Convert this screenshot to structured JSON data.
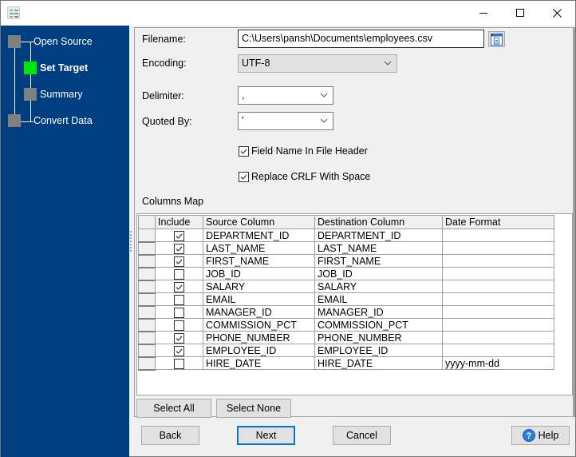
{
  "window": {
    "app_icon": "app-grid-icon",
    "controls": {
      "minimize": "minimize-icon",
      "maximize": "maximize-icon",
      "close": "close-icon"
    }
  },
  "sidebar": {
    "steps": [
      {
        "label": "Open Source",
        "state": "inactive"
      },
      {
        "label": "Set Target",
        "state": "active"
      },
      {
        "label": "Summary",
        "state": "inactive"
      },
      {
        "label": "Convert Data",
        "state": "inactive"
      }
    ],
    "colors": {
      "background": "#003f7f",
      "active": "#00e600",
      "inactive": "#808080"
    }
  },
  "form": {
    "filename_label": "Filename:",
    "filename_value": "C:\\Users\\pansh\\Documents\\employees.csv",
    "encoding_label": "Encoding:",
    "encoding_value": "UTF-8",
    "delimiter_label": "Delimiter:",
    "delimiter_value": ",",
    "quoted_by_label": "Quoted By:",
    "quoted_by_value": "'",
    "field_name_header_label": "Field Name In File Header",
    "field_name_header_checked": true,
    "replace_crlf_label": "Replace CRLF With Space",
    "replace_crlf_checked": true,
    "columns_map_label": "Columns Map"
  },
  "grid": {
    "headers": [
      "Include",
      "Source Column",
      "Destination Column",
      "Date Format"
    ],
    "rows": [
      {
        "include": true,
        "source": "DEPARTMENT_ID",
        "destination": "DEPARTMENT_ID",
        "date_format": ""
      },
      {
        "include": true,
        "source": "LAST_NAME",
        "destination": "LAST_NAME",
        "date_format": ""
      },
      {
        "include": true,
        "source": "FIRST_NAME",
        "destination": "FIRST_NAME",
        "date_format": ""
      },
      {
        "include": false,
        "source": "JOB_ID",
        "destination": "JOB_ID",
        "date_format": ""
      },
      {
        "include": true,
        "source": "SALARY",
        "destination": "SALARY",
        "date_format": ""
      },
      {
        "include": false,
        "source": "EMAIL",
        "destination": "EMAIL",
        "date_format": ""
      },
      {
        "include": false,
        "source": "MANAGER_ID",
        "destination": "MANAGER_ID",
        "date_format": ""
      },
      {
        "include": false,
        "source": "COMMISSION_PCT",
        "destination": "COMMISSION_PCT",
        "date_format": ""
      },
      {
        "include": true,
        "source": "PHONE_NUMBER",
        "destination": "PHONE_NUMBER",
        "date_format": ""
      },
      {
        "include": true,
        "source": "EMPLOYEE_ID",
        "destination": "EMPLOYEE_ID",
        "date_format": ""
      },
      {
        "include": false,
        "source": "HIRE_DATE",
        "destination": "HIRE_DATE",
        "date_format": "yyyy-mm-dd"
      }
    ]
  },
  "buttons": {
    "select_all": "Select All",
    "select_none": "Select None",
    "back": "Back",
    "next": "Next",
    "cancel": "Cancel",
    "help": "Help"
  }
}
